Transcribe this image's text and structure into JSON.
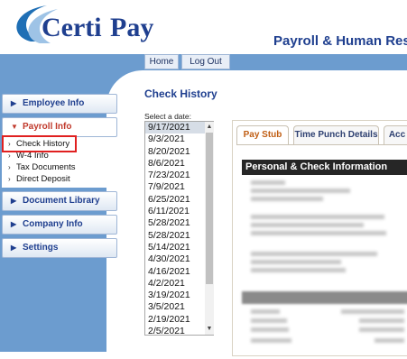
{
  "brand": {
    "logo_text": "CertiPay",
    "logo_prefix": "Certi",
    "logo_suffix": "Pay",
    "accent": "#1f3f8f",
    "arc_color": "#1f6fb5"
  },
  "header": {
    "title": "Payroll & Human Res"
  },
  "nav": {
    "home": "Home",
    "logout": "Log Out"
  },
  "sidebar": {
    "employee_info": "Employee Info",
    "payroll_info": "Payroll Info",
    "submenu": [
      "Check History",
      "W-4 Info",
      "Tax Documents",
      "Direct Deposit"
    ],
    "document_library": "Document Library",
    "company_info": "Company Info",
    "settings": "Settings"
  },
  "main": {
    "title": "Check History",
    "select_label": "Select a date:",
    "dates": [
      "9/17/2021",
      "9/3/2021",
      "8/20/2021",
      "8/6/2021",
      "7/23/2021",
      "7/9/2021",
      "6/25/2021",
      "6/11/2021",
      "5/28/2021",
      "5/28/2021",
      "5/14/2021",
      "4/30/2021",
      "4/16/2021",
      "4/2/2021",
      "3/19/2021",
      "3/5/2021",
      "2/19/2021",
      "2/5/2021"
    ],
    "selected_date": "9/17/2021"
  },
  "tabs": [
    "Pay Stub",
    "Time Punch Details",
    "Acc"
  ],
  "panel": {
    "section_title": "Personal & Check Information"
  },
  "colors": {
    "blue_bg": "#6c9ccf",
    "highlight_red": "#e02020",
    "active_tab": "#c05e13"
  }
}
